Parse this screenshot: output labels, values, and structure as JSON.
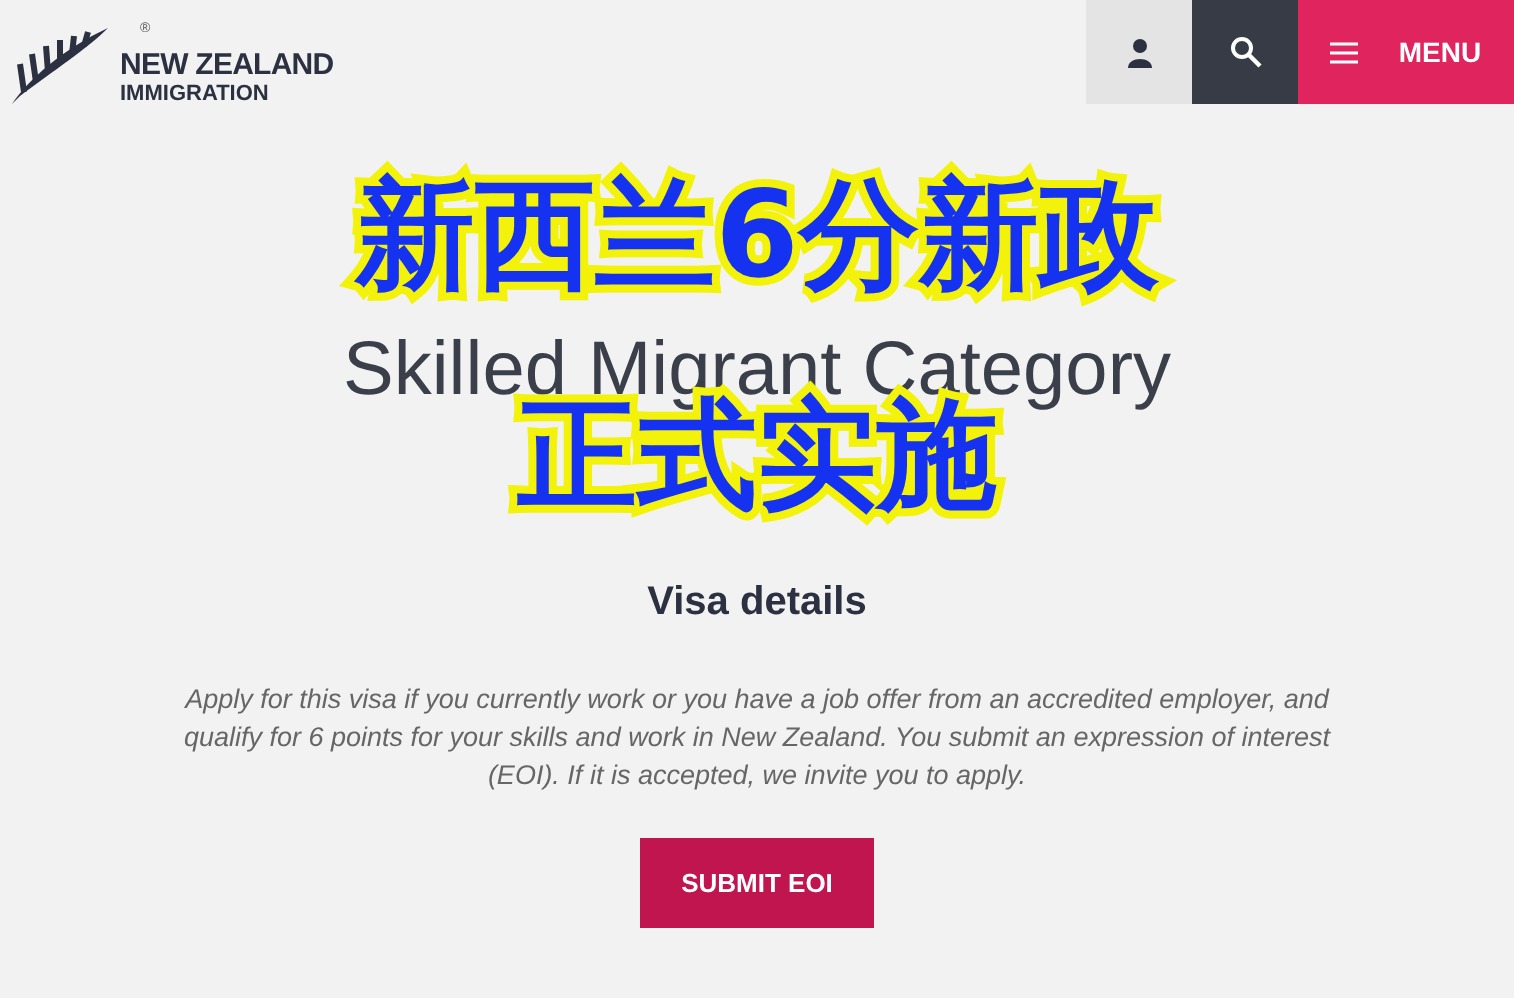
{
  "header": {
    "logo_line1": "NEW ZEALAND",
    "logo_line2": "IMMIGRATION",
    "logo_mark": "®",
    "menu_label": "MENU"
  },
  "page": {
    "title": "Skilled Migrant Category",
    "section_heading": "Visa details",
    "description": "Apply for this visa if you currently work or you have a job offer from an accredited employer, and qualify for 6 points for your skills and work in New Zealand. You submit an expression of interest (EOI). If it is accepted, we invite you to apply.",
    "button": "SUBMIT EOI"
  },
  "overlay_caption": [
    "新西兰6分新政",
    "正式实施"
  ]
}
